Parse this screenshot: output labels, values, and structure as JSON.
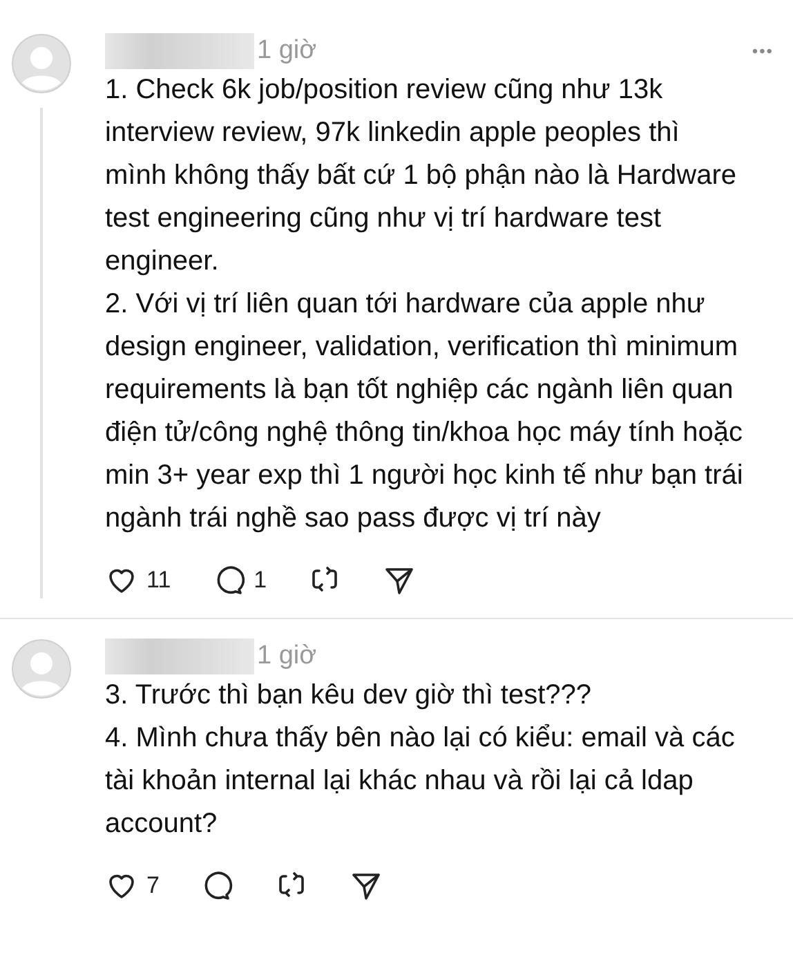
{
  "comments": [
    {
      "time": "1 giờ",
      "more": "•••",
      "paragraphs": [
        "1. Check 6k job/position review cũng như 13k interview review, 97k linkedin apple peoples thì mình không thấy bất cứ 1 bộ phận nào là Hardware test engineering cũng như vị trí hardware test engineer.",
        "2. Với vị trí liên quan tới hardware của apple như design engineer, validation, verification thì minimum requirements là bạn tốt nghiệp các ngành liên quan điện tử/công nghệ thông tin/khoa học máy tính hoặc min 3+ year exp thì 1 người học kinh tế như bạn trái ngành trái nghề sao pass được vị trí này"
      ],
      "likes": "11",
      "replies": "1",
      "has_thread_line": true
    },
    {
      "time": "1 giờ",
      "paragraphs": [
        "3. Trước thì bạn kêu dev giờ thì test???",
        "4. Mình chưa thấy bên nào lại có kiểu: email và các tài khoản internal lại khác nhau và rồi lại cả ldap account?"
      ],
      "likes": "7",
      "has_thread_line": false
    }
  ]
}
